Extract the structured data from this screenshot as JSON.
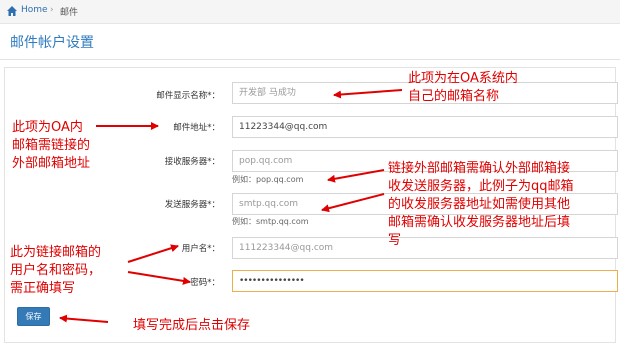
{
  "breadcrumb": {
    "home": "Home",
    "separator": "›",
    "current": "邮件"
  },
  "page_title": "邮件帐户设置",
  "form": {
    "display_name": {
      "label": "邮件显示名称*：",
      "value": "开发部 马成功"
    },
    "email": {
      "label": "邮件地址*：",
      "value": "11223344@qq.com"
    },
    "incoming": {
      "label": "接收服务器*：",
      "value": "pop.qq.com",
      "hint": "例如：pop.qq.com"
    },
    "outgoing": {
      "label": "发送服务器*：",
      "value": "smtp.qq.com",
      "hint": "例如：smtp.qq.com"
    },
    "username": {
      "label": "用户名*：",
      "value": "111223344@qq.com"
    },
    "password": {
      "label": "密码*：",
      "value": "•••••••••••••••"
    }
  },
  "save_label": "保存",
  "annotations": {
    "a1_line1": "此项为在OA系统内",
    "a1_line2": "自己的邮箱名称",
    "a2_line1": "此项为OA内",
    "a2_line2": "邮箱需链接的",
    "a2_line3": "外部邮箱地址",
    "a3_line1": "链接外部邮箱需确认外部邮箱接",
    "a3_line2": "收发送服务器，此例子为qq邮箱",
    "a3_line3": "的收发服务器地址如需使用其他",
    "a3_line4": "邮箱需确认收发服务器地址后填",
    "a3_line5": "写",
    "a4_line1": "此为链接邮箱的",
    "a4_line2": "用户名和密码，",
    "a4_line3": "需正确填写",
    "a5": "填写完成后点击保存"
  },
  "colors": {
    "accent": "#2f7bbf",
    "annotation": "#e00000",
    "button": "#337ab7"
  }
}
